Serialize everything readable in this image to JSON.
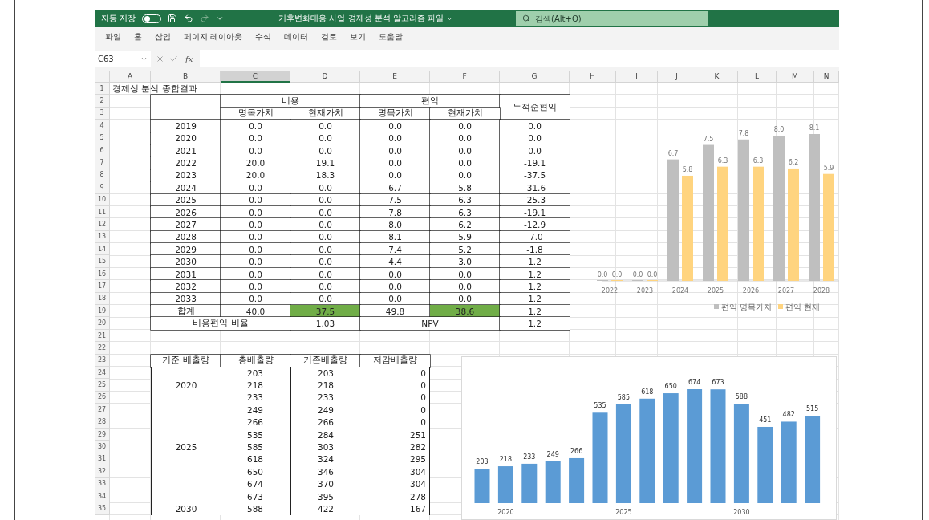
{
  "titlebar": {
    "autosave": {
      "label": "자동 저장",
      "on": false
    },
    "quick_access": [
      {
        "kind": "save",
        "disabled": false
      },
      {
        "kind": "undo",
        "disabled": false
      },
      {
        "kind": "redo",
        "disabled": true
      },
      {
        "kind": "customize",
        "disabled": false
      }
    ],
    "title": "기후변화대응 사업 경제성 분석 알고리즘 파일",
    "search": {
      "placeholder": "검색(Alt+Q)"
    }
  },
  "menu": [
    "파일",
    "홈",
    "삽입",
    "페이지 레이아웃",
    "수식",
    "데이터",
    "검토",
    "보기",
    "도움말"
  ],
  "formula_bar": {
    "name_box": "C63",
    "function_label": "fx"
  },
  "sheet": {
    "columns": [
      {
        "label": "A",
        "selected": false
      },
      {
        "label": "B",
        "selected": false
      },
      {
        "label": "C",
        "selected": true
      },
      {
        "label": "D",
        "selected": false
      },
      {
        "label": "E",
        "selected": false
      },
      {
        "label": "F",
        "selected": false
      },
      {
        "label": "G",
        "selected": false
      },
      {
        "label": "H",
        "selected": false
      },
      {
        "label": "I",
        "selected": false
      },
      {
        "label": "J",
        "selected": false
      },
      {
        "label": "K",
        "selected": false
      },
      {
        "label": "L",
        "selected": false
      },
      {
        "label": "M",
        "selected": false
      },
      {
        "label": "N",
        "selected": false
      }
    ],
    "rows": [
      "1",
      "2",
      "3",
      "4",
      "5",
      "6",
      "7",
      "8",
      "9",
      "10",
      "11",
      "12",
      "13",
      "14",
      "15",
      "16",
      "17",
      "18",
      "19",
      "20",
      "21",
      "22",
      "23",
      "24",
      "25",
      "26",
      "27",
      "28",
      "29",
      "30",
      "31",
      "32",
      "33",
      "34",
      "35"
    ],
    "title": "경제성 분석 종합결과",
    "summary_table": {
      "groups": [
        "비용",
        "편익"
      ],
      "cumulative_header": "누적순편익",
      "subheaders": [
        "명목가치",
        "현재가치",
        "명목가치",
        "현재가치"
      ],
      "rows": [
        {
          "year": "2019",
          "values": [
            "0.0",
            "0.0",
            "0.0",
            "0.0",
            "0.0"
          ]
        },
        {
          "year": "2020",
          "values": [
            "0.0",
            "0.0",
            "0.0",
            "0.0",
            "0.0"
          ]
        },
        {
          "year": "2021",
          "values": [
            "0.0",
            "0.0",
            "0.0",
            "0.0",
            "0.0"
          ]
        },
        {
          "year": "2022",
          "values": [
            "20.0",
            "19.1",
            "0.0",
            "0.0",
            "-19.1"
          ]
        },
        {
          "year": "2023",
          "values": [
            "20.0",
            "18.3",
            "0.0",
            "0.0",
            "-37.5"
          ]
        },
        {
          "year": "2024",
          "values": [
            "0.0",
            "0.0",
            "6.7",
            "5.8",
            "-31.6"
          ]
        },
        {
          "year": "2025",
          "values": [
            "0.0",
            "0.0",
            "7.5",
            "6.3",
            "-25.3"
          ]
        },
        {
          "year": "2026",
          "values": [
            "0.0",
            "0.0",
            "7.8",
            "6.3",
            "-19.1"
          ]
        },
        {
          "year": "2027",
          "values": [
            "0.0",
            "0.0",
            "8.0",
            "6.2",
            "-12.9"
          ]
        },
        {
          "year": "2028",
          "values": [
            "0.0",
            "0.0",
            "8.1",
            "5.9",
            "-7.0"
          ]
        },
        {
          "year": "2029",
          "values": [
            "0.0",
            "0.0",
            "7.4",
            "5.2",
            "-1.8"
          ]
        },
        {
          "year": "2030",
          "values": [
            "0.0",
            "0.0",
            "4.4",
            "3.0",
            "1.2"
          ]
        },
        {
          "year": "2031",
          "values": [
            "0.0",
            "0.0",
            "0.0",
            "0.0",
            "1.2"
          ]
        },
        {
          "year": "2032",
          "values": [
            "0.0",
            "0.0",
            "0.0",
            "0.0",
            "1.2"
          ]
        },
        {
          "year": "2033",
          "values": [
            "0.0",
            "0.0",
            "0.0",
            "0.0",
            "1.2"
          ]
        }
      ],
      "total": {
        "label": "합계",
        "cells": [
          {
            "value": "40.0",
            "highlighted": false
          },
          {
            "value": "37.5",
            "highlighted": true
          },
          {
            "value": "49.8",
            "highlighted": false
          },
          {
            "value": "38.6",
            "highlighted": true
          },
          {
            "value": "1.2",
            "highlighted": false
          }
        ]
      },
      "ratio": {
        "label": "비용편익 비율",
        "value": "1.03",
        "npv_label": "NPV",
        "npv_value": "1.2"
      }
    },
    "emission_table": {
      "headers": [
        "기준 배출량",
        "총배출량",
        "기존배출량",
        "저감배출량"
      ],
      "rows": [
        {
          "total": "203",
          "base": "203",
          "reduced": "0"
        },
        {
          "period": "2020",
          "total": "218",
          "base": "218",
          "reduced": "0"
        },
        {
          "total": "233",
          "base": "233",
          "reduced": "0"
        },
        {
          "total": "249",
          "base": "249",
          "reduced": "0"
        },
        {
          "total": "266",
          "base": "266",
          "reduced": "0"
        },
        {
          "total": "535",
          "base": "284",
          "reduced": "251"
        },
        {
          "period": "2025",
          "total": "585",
          "base": "303",
          "reduced": "282"
        },
        {
          "total": "618",
          "base": "324",
          "reduced": "295"
        },
        {
          "total": "650",
          "base": "346",
          "reduced": "304"
        },
        {
          "total": "674",
          "base": "370",
          "reduced": "304"
        },
        {
          "total": "673",
          "base": "395",
          "reduced": "278"
        },
        {
          "period": "2030",
          "total": "588",
          "base": "422",
          "reduced": "167"
        }
      ]
    },
    "charts": [
      {
        "chart_data": {
          "type": "bar",
          "categories": [
            "2022",
            "2023",
            "2024",
            "2025",
            "2026",
            "2027",
            "2028"
          ],
          "legend": "bottom",
          "series": [
            {
              "name": "편익 명목가치",
              "color": "#bfbfbf",
              "values": [
                0.0,
                0.0,
                6.7,
                7.5,
                7.8,
                8.0,
                8.1
              ],
              "value_labels": [
                "0.0",
                "0.0",
                "6.7",
                "7.5",
                "7.8",
                "8.0",
                "8.1"
              ]
            },
            {
              "name": "편익 현재",
              "color": "#ffd47f",
              "values": [
                0.0,
                0.0,
                5.8,
                6.3,
                6.3,
                6.2,
                5.9
              ],
              "value_labels": [
                "0.0",
                "0.0",
                "5.8",
                "6.3",
                "6.3",
                "6.2",
                "5.9"
              ]
            }
          ]
        }
      },
      {
        "chart_data": {
          "type": "bar",
          "categories": [
            null,
            "2020",
            null,
            null,
            null,
            null,
            "2025",
            null,
            null,
            null,
            null,
            "2030",
            null,
            null,
            null
          ],
          "series": [
            {
              "color": "#5b9bd5",
              "values": [
                203,
                218,
                233,
                249,
                266,
                535,
                585,
                618,
                650,
                674,
                673,
                588,
                451,
                482,
                515
              ],
              "value_labels": [
                "203",
                "218",
                "233",
                "249",
                "266",
                "535",
                "585",
                "618",
                "650",
                "674",
                "673",
                "588",
                "451",
                "482",
                "515"
              ]
            }
          ]
        }
      }
    ]
  }
}
